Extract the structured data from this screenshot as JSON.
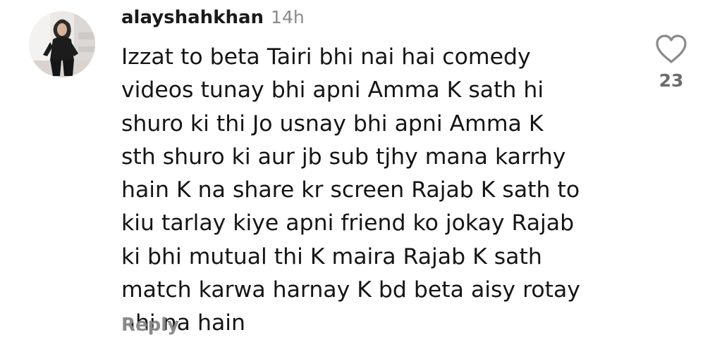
{
  "comment": {
    "username": "alayshahkhan",
    "timestamp": "14h",
    "lines": [
      "Izzat to beta Tairi bhi nai hai comedy",
      "videos tunay bhi apni Amma  K sath hi",
      "shuro ki thi Jo usnay bhi apni Amma  K",
      "sth shuro ki aur jb sub tjhy mana karrhy",
      "hain K na share kr screen Rajab K sath to",
      "kiu tarlay kiye apni friend ko jokay Rajab",
      "ki bhi mutual thi K maira Rajab K sath",
      "match karwa harnay K bd beta aisy rotay",
      "nhi na hain"
    ],
    "like_count": "23",
    "reply_label": "Reply",
    "avatar_icon": "profile-avatar",
    "like_icon": "heart-outline-icon"
  },
  "colors": {
    "text": "#151515",
    "muted": "#8a8a8a",
    "like_count": "#6b6b6b"
  }
}
